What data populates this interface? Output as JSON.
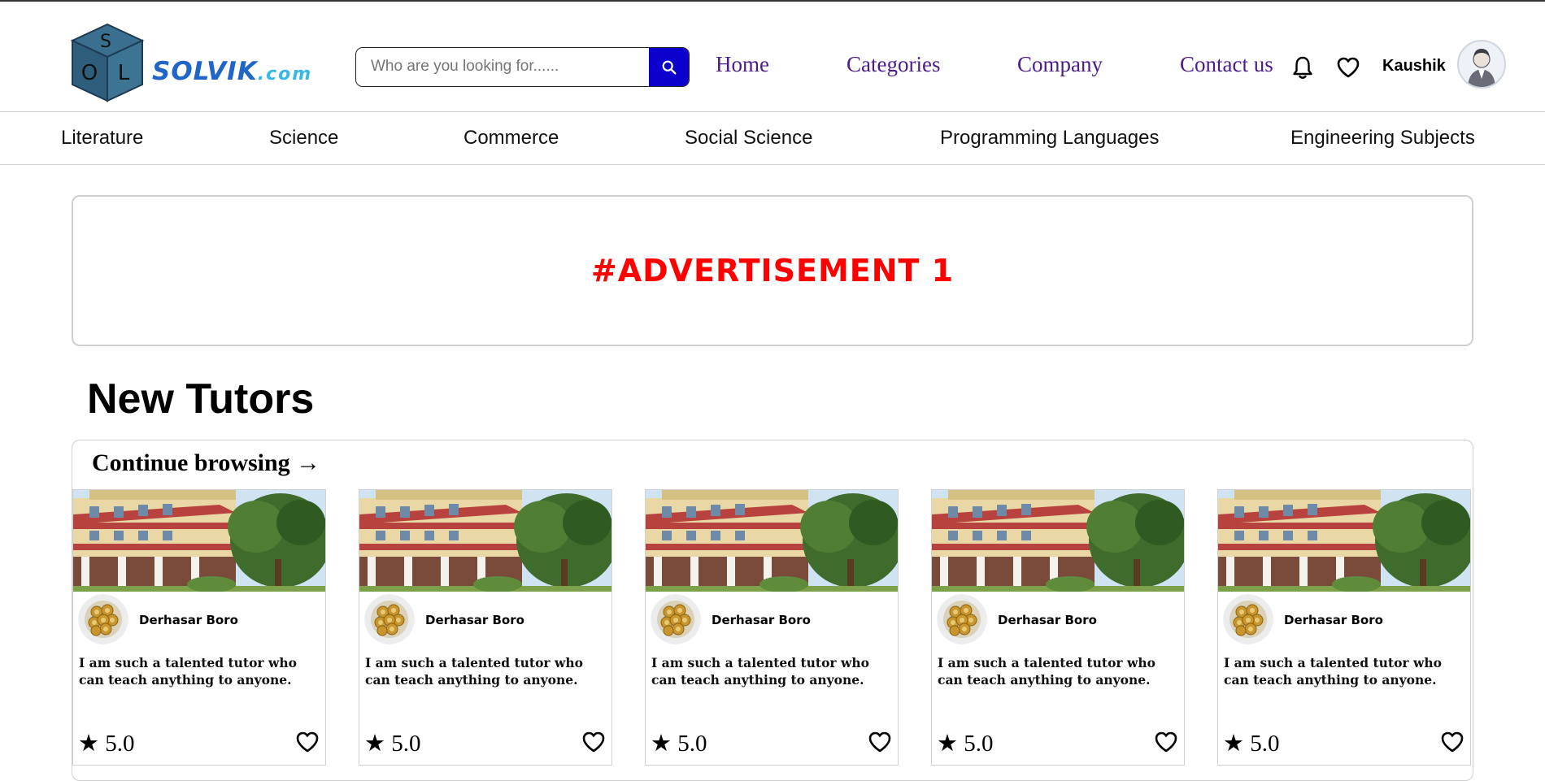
{
  "brand": {
    "name": "SOLVIK",
    "domain": ".com",
    "cube_letters": [
      "S",
      "O",
      "L"
    ]
  },
  "search": {
    "placeholder": "Who are you looking for......",
    "value": ""
  },
  "nav": {
    "links": [
      "Home",
      "Categories",
      "Company",
      "Contact us"
    ],
    "user_name": "Kaushik"
  },
  "subnav": {
    "items": [
      "Literature",
      "Science",
      "Commerce",
      "Social Science",
      "Programming Languages",
      "Engineering Subjects"
    ]
  },
  "ad": {
    "text": "#ADVERTISEMENT 1",
    "color": "#ff0000"
  },
  "section": {
    "title": "New Tutors",
    "continue_label": "Continue browsing →"
  },
  "tutors": [
    {
      "name": "Derhasar Boro",
      "description": "I am such a talented tutor who can teach anything to anyone.",
      "rating": "★ 5.0"
    },
    {
      "name": "Derhasar Boro",
      "description": "I am such a talented tutor who can teach anything to anyone.",
      "rating": "★ 5.0"
    },
    {
      "name": "Derhasar Boro",
      "description": "I am such a talented tutor who can teach anything to anyone.",
      "rating": "★ 5.0"
    },
    {
      "name": "Derhasar Boro",
      "description": "I am such a talented tutor who can teach anything to anyone.",
      "rating": "★ 5.0"
    },
    {
      "name": "Derhasar Boro",
      "description": "I am such a talented tutor who can teach anything to anyone.",
      "rating": "★ 5.0"
    }
  ],
  "icons": {
    "search": "search-icon",
    "notifications": "bell-icon",
    "favorites": "heart-icon",
    "avatar": "user-avatar",
    "card_favorite": "heart-icon"
  },
  "colors": {
    "nav_link": "#4b1c8c",
    "search_button": "#0b00cc",
    "brand_blue": "#1f66c8",
    "brand_cyan": "#39b7e8"
  }
}
